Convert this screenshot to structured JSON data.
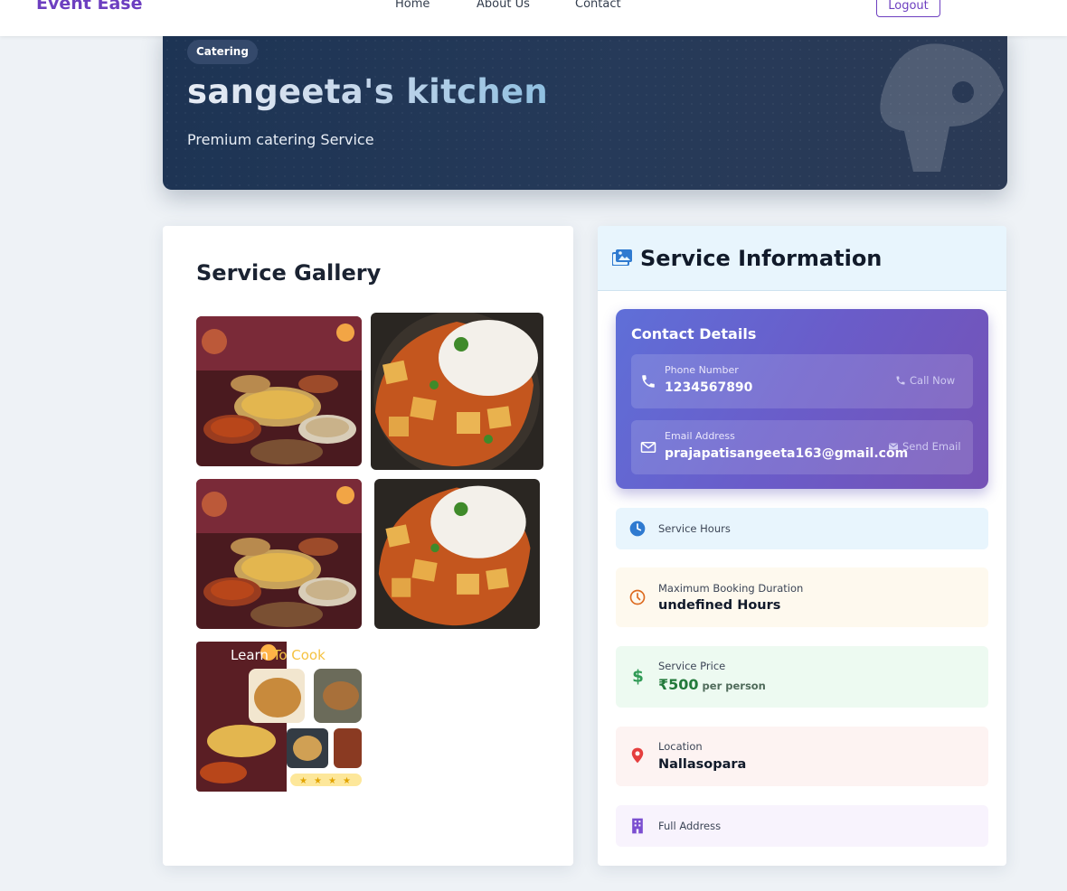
{
  "nav": {
    "brand": "Event Ease",
    "links": [
      "Home",
      "About Us",
      "Contact"
    ],
    "logout_label": "Logout"
  },
  "hero": {
    "badge": "Catering",
    "title": "sangeeta's kitchen",
    "subtitle": "Premium catering Service"
  },
  "gallery": {
    "title": "Service Gallery",
    "images": [
      {
        "alt": "Indian feast spread"
      },
      {
        "alt": "Paneer curry with rice"
      },
      {
        "alt": "Indian feast spread"
      },
      {
        "alt": "Paneer curry with rice"
      },
      {
        "alt": "Learn To Cook collage"
      }
    ],
    "collage_caption_white": "Learn ",
    "collage_caption_gold": "To Cook"
  },
  "info": {
    "title": "Service Information",
    "contact": {
      "title": "Contact Details",
      "phone_label": "Phone Number",
      "phone_value": "1234567890",
      "phone_action": "Call Now",
      "email_label": "Email Address",
      "email_value": "prajapatisangeeta163@gmail.com",
      "email_action": "Send Email"
    },
    "hours_label": "Service Hours",
    "duration_label": "Maximum Booking Duration",
    "duration_value": "undefined Hours",
    "price_label": "Service Price",
    "price_value": "₹500",
    "price_unit": "per person",
    "location_label": "Location",
    "location_value": "Nallasopara",
    "address_label": "Full Address"
  },
  "colors": {
    "brand": "#6d3fc0",
    "hero_bg": "#1d3454",
    "contact_gradient_start": "#5f6fd8",
    "contact_gradient_end": "#7552b5",
    "hours_bg": "#e8f5fd",
    "duration_bg": "#fef9ee",
    "price_bg": "#edfaf1",
    "location_bg": "#fdf3f2",
    "address_bg": "#f8f3fd"
  }
}
